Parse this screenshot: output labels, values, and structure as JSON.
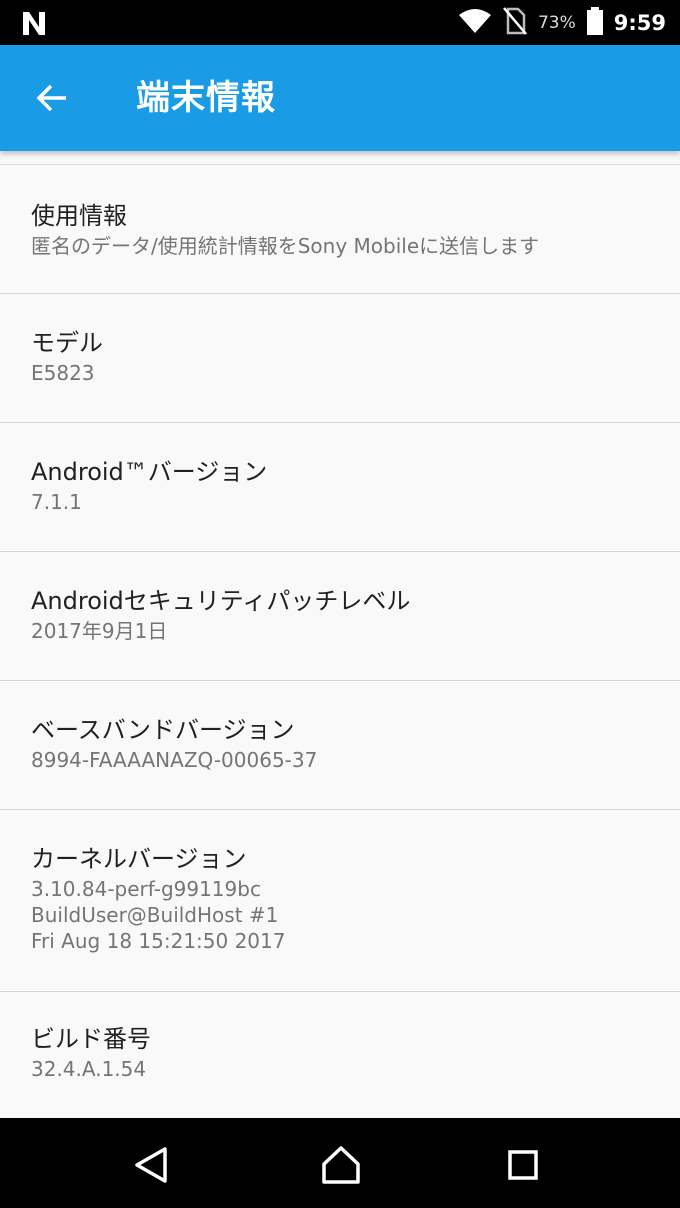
{
  "status_bar": {
    "battery_percent": "73%",
    "time": "9:59",
    "icons": [
      "notification-n-icon",
      "wifi-icon",
      "no-sim-icon",
      "battery-icon"
    ]
  },
  "app_bar": {
    "title": "端末情報",
    "back_icon": "back-arrow-icon",
    "background_color": "#1a9be6"
  },
  "items": [
    {
      "title": "使用情報",
      "summary": "匿名のデータ/使用統計情報をSony Mobileに送信します"
    },
    {
      "title": "モデル",
      "summary": "E5823"
    },
    {
      "title": "Android™バージョン",
      "summary": "7.1.1"
    },
    {
      "title": "Androidセキュリティパッチレベル",
      "summary": "2017年9月1日"
    },
    {
      "title": "ベースバンドバージョン",
      "summary": "8994-FAAAANAZQ-00065-37"
    },
    {
      "title": "カーネルバージョン",
      "summary": "3.10.84-perf-g99119bc\nBuildUser@BuildHost #1\nFri Aug 18 15:21:50 2017"
    },
    {
      "title": "ビルド番号",
      "summary": "32.4.A.1.54"
    }
  ],
  "nav_bar": {
    "buttons": [
      "nav-back-icon",
      "nav-home-icon",
      "nav-recents-icon"
    ]
  }
}
